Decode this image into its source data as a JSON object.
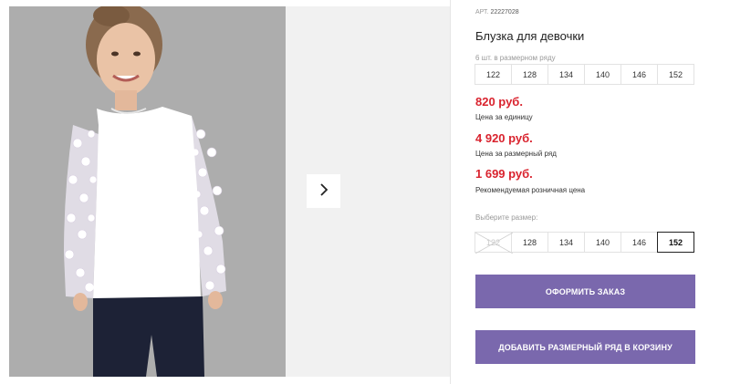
{
  "product": {
    "art_label": "АРТ.",
    "art_number": "22227028",
    "title": "Блузка для девочки",
    "pack_note": "6 шт. в размерном ряду",
    "pack_sizes": [
      "122",
      "128",
      "134",
      "140",
      "146",
      "152"
    ]
  },
  "prices": [
    {
      "value": "820 руб.",
      "label": "Цена за единицу"
    },
    {
      "value": "4 920 руб.",
      "label": "Цена за размерный ряд"
    },
    {
      "value": "1 699 руб.",
      "label": "Рекомендуемая розничная цена"
    }
  ],
  "size_picker": {
    "label": "Выберите размер:",
    "options": [
      {
        "size": "122",
        "state": "unavailable"
      },
      {
        "size": "128",
        "state": "available"
      },
      {
        "size": "134",
        "state": "available"
      },
      {
        "size": "140",
        "state": "available"
      },
      {
        "size": "146",
        "state": "available"
      },
      {
        "size": "152",
        "state": "selected"
      }
    ]
  },
  "buttons": {
    "order": "ОФОРМИТЬ ЗАКАЗ",
    "add_to_cart": "ДОБАВИТЬ РАЗМЕРНЫЙ РЯД В КОРЗИНУ"
  },
  "gallery": {
    "next_icon": "chevron-right-icon"
  },
  "colors": {
    "price_red": "#d9232e",
    "button_purple": "#7a68ad",
    "photo_bg": "#aeaeae",
    "gallery_bg": "#f1f1f1"
  }
}
